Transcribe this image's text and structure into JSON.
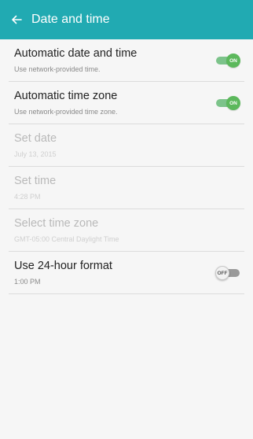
{
  "header": {
    "title": "Date and time",
    "back_icon": "arrow-left-icon"
  },
  "colors": {
    "accent": "#21aab2",
    "switch_on": "#5cb85c",
    "switch_off": "#9a9a9a"
  },
  "settings": [
    {
      "title": "Automatic date and time",
      "subtitle": "Use network-provided time.",
      "switch": "ON",
      "enabled": true
    },
    {
      "title": "Automatic time zone",
      "subtitle": "Use network-provided time zone.",
      "switch": "ON",
      "enabled": true
    },
    {
      "title": "Set date",
      "subtitle": "July 13, 2015",
      "enabled": false
    },
    {
      "title": "Set time",
      "subtitle": "4:28 PM",
      "enabled": false
    },
    {
      "title": "Select time zone",
      "subtitle": "GMT-05:00 Central Daylight Time",
      "enabled": false
    },
    {
      "title": "Use 24-hour format",
      "subtitle": "1:00 PM",
      "switch": "OFF",
      "enabled": true
    }
  ]
}
